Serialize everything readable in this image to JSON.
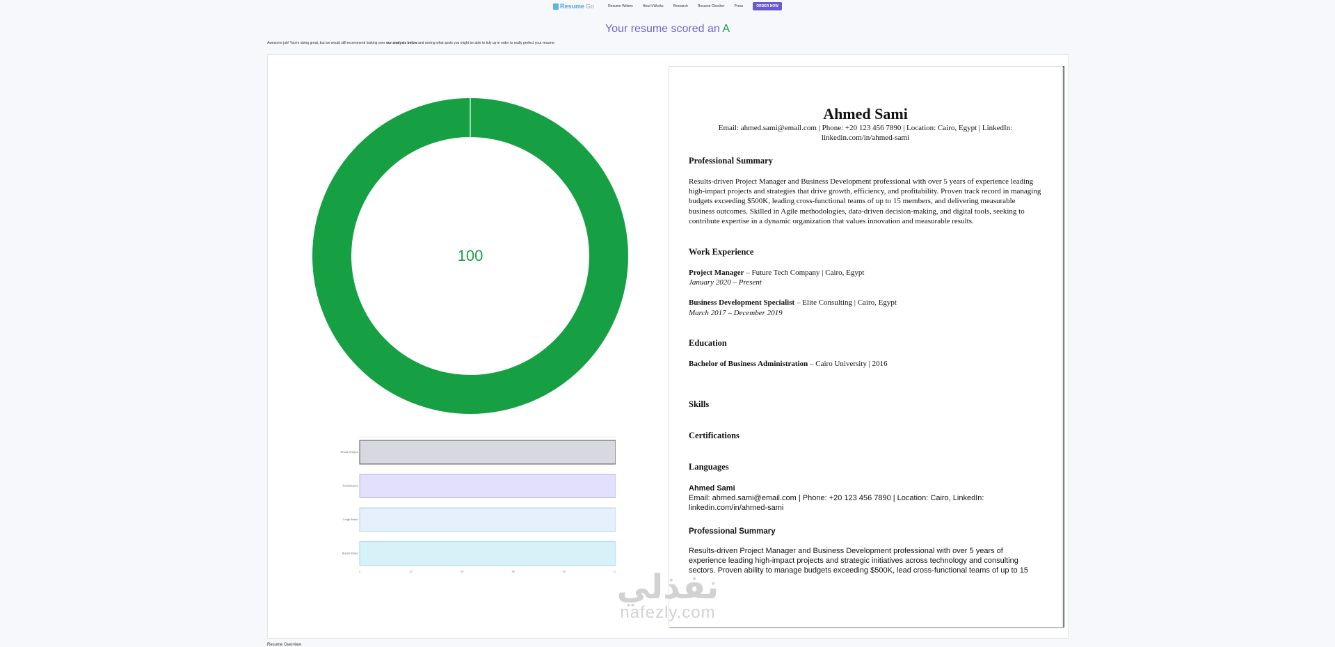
{
  "nav": {
    "logo_a": "Resume",
    "logo_b": "Go",
    "links": [
      "Resume Writers",
      "How It Works",
      "Research",
      "Resume Checker",
      "Press"
    ],
    "order_label": "ORDER NOW"
  },
  "headline": {
    "prefix": "Your resume scored an ",
    "grade": "A"
  },
  "subline": {
    "pre": "Awesome job! You're doing great, but we would still recommend looking over ",
    "bold": "our analysis below",
    "post": " and seeing what spots you might be able to tidy up in order to really perfect your resume."
  },
  "score": {
    "value": "100",
    "fraction": 1.0,
    "color": "#16a043"
  },
  "chart_data": {
    "type": "bar",
    "orientation": "horizontal",
    "categories": [
      "Resume Synopsis",
      "Standardization",
      "Length Subject",
      "Resume Subject"
    ],
    "values": [
      100,
      100,
      100,
      100
    ],
    "colors": [
      "#d7d8e0",
      "#e2e0fa",
      "#e6effc",
      "#d7f1f8"
    ],
    "edge_colors": [
      "#555555",
      "#b9b4ef",
      "#b6cff0",
      "#9fd8e8"
    ],
    "xticks": [
      "0",
      "20",
      "40",
      "60",
      "80",
      "100"
    ],
    "xlim": [
      0,
      100
    ]
  },
  "resume": {
    "name": "Ahmed Sami",
    "contact": "Email: ahmed.sami@email.com | Phone: +20 123 456 7890 | Location: Cairo, Egypt | LinkedIn: linkedin.com/in/ahmed-sami",
    "summary_heading": "Professional Summary",
    "summary": "Results-driven Project Manager and Business Development professional with over 5 years of experience leading high-impact projects and strategies that drive growth, efficiency, and profitability. Proven track record in managing budgets exceeding $500K, leading cross-functional teams of up to 15 members, and delivering measurable business outcomes. Skilled in Agile methodologies, data-driven decision-making, and digital tools, seeking to contribute expertise in a dynamic organization that values innovation and measurable results.",
    "work_heading": "Work Experience",
    "job1_title": "Project Manager",
    "job1_org": " – Future Tech Company | Cairo, Egypt",
    "job1_dates": "January 2020 – Present",
    "job2_title": "Business Development Specialist",
    "job2_org": " – Elite Consulting | Cairo, Egypt",
    "job2_dates": "March 2017 – December 2019",
    "edu_heading": "Education",
    "edu_degree": "Bachelor of Business Administration",
    "edu_org": " – Cairo University | 2016",
    "skills_heading": "Skills",
    "cert_heading": "Certifications",
    "lang_heading": "Languages",
    "dup_name": "Ahmed Sami",
    "dup_contact": "Email: ahmed.sami@email.com | Phone: +20 123 456 7890 | Location: Cairo, LinkedIn: linkedin.com/in/ahmed-sami",
    "dup_summary_heading": "Professional Summary",
    "dup_summary": "Results-driven Project Manager and Business Development professional with over 5 years of experience leading high-impact projects and strategic initiatives across technology and consulting sectors. Proven ability to manage budgets exceeding $500K, lead cross-functional teams of up to 15"
  },
  "watermark": {
    "ar": "نفذلي",
    "en": "nafezly.com"
  },
  "footer": {
    "label": "Resume Overview"
  }
}
